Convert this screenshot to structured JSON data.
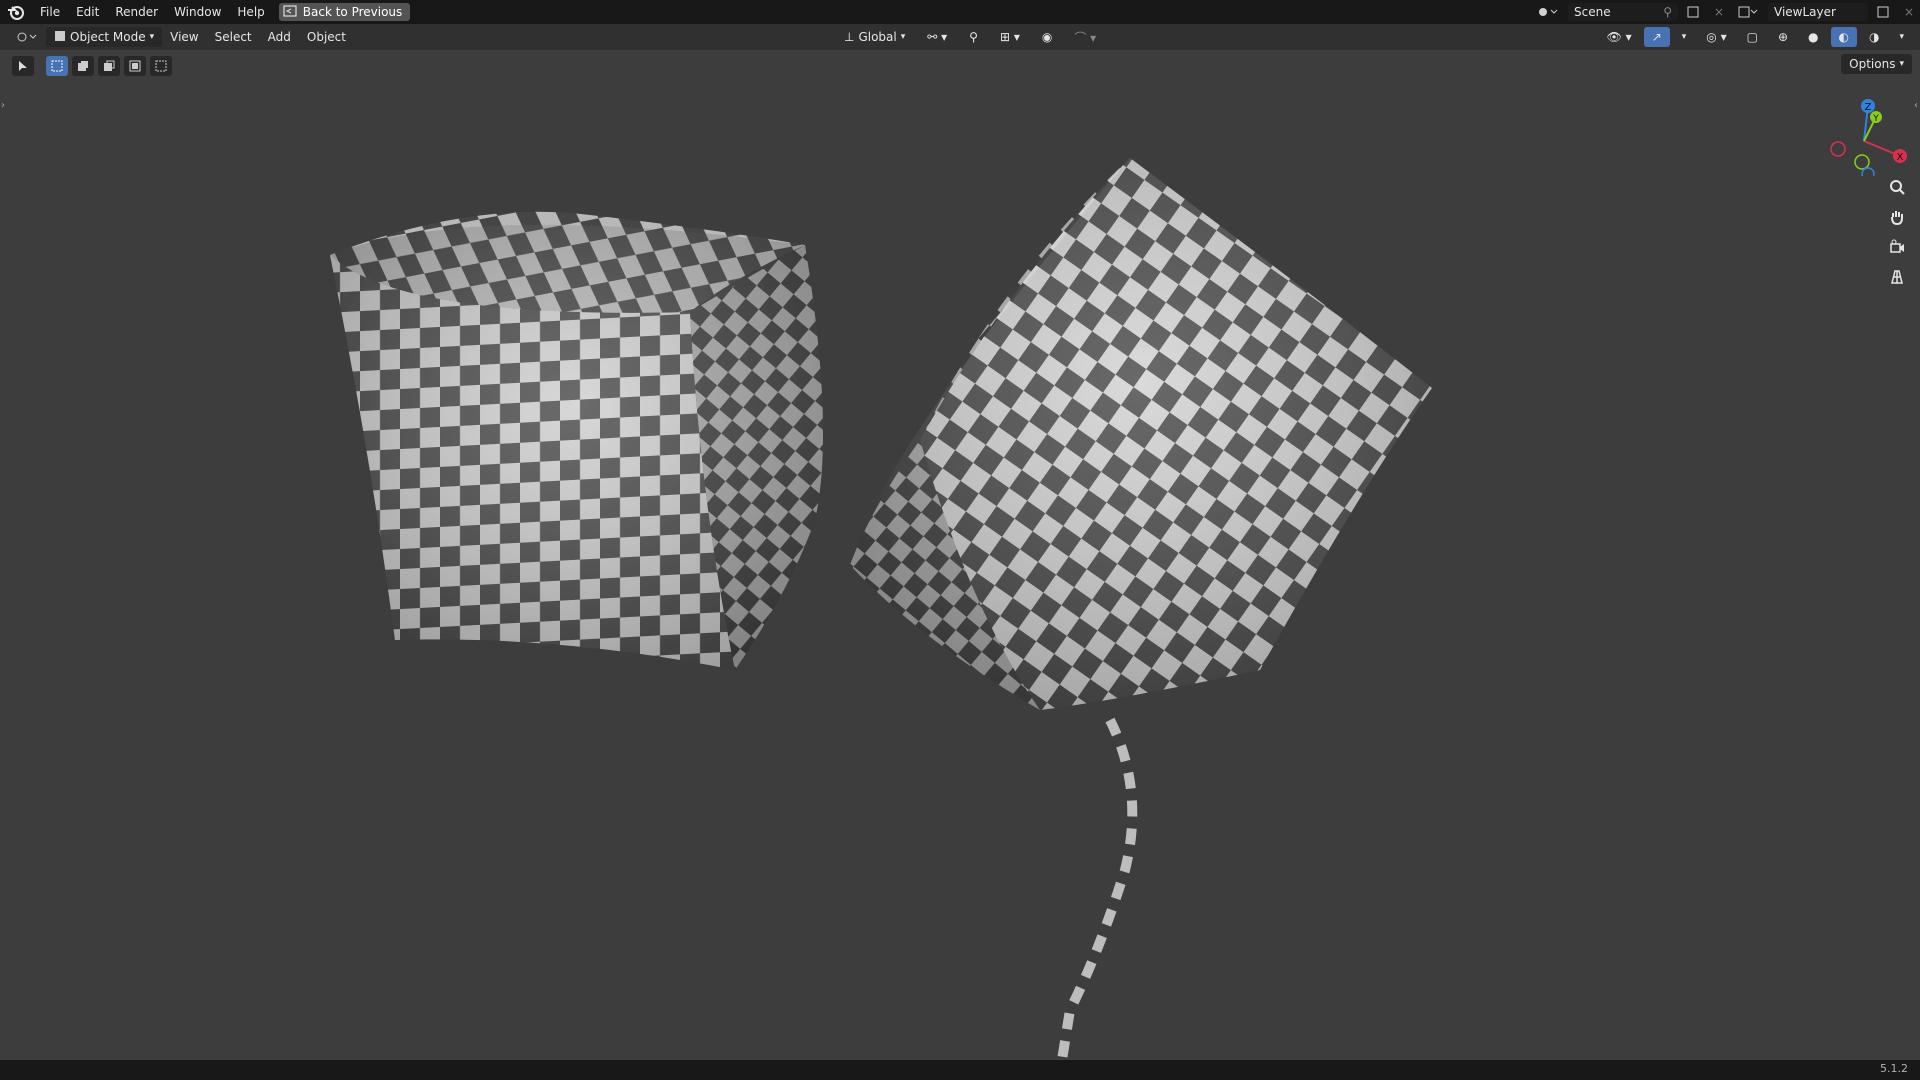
{
  "menu": {
    "file": "File",
    "edit": "Edit",
    "render": "Render",
    "window": "Window",
    "help": "Help"
  },
  "back_button": "Back to Previous",
  "scene": {
    "name": "Scene"
  },
  "view_layer": {
    "name": "ViewLayer"
  },
  "header": {
    "mode": "Object Mode",
    "view": "View",
    "select": "Select",
    "add": "Add",
    "object": "Object",
    "transform_orientation": "Global",
    "options": "Options"
  },
  "gizmo": {
    "z": "Z",
    "y": "Y",
    "x": "X"
  },
  "status": {
    "version": "5.1.2"
  },
  "colors": {
    "active_blue": "#4772b3",
    "checker_light": "#cfcfcf",
    "checker_dark": "#4a4a4a",
    "axis_x": "#d9304f",
    "axis_y": "#8bcc1f",
    "axis_z": "#2f84e3"
  }
}
